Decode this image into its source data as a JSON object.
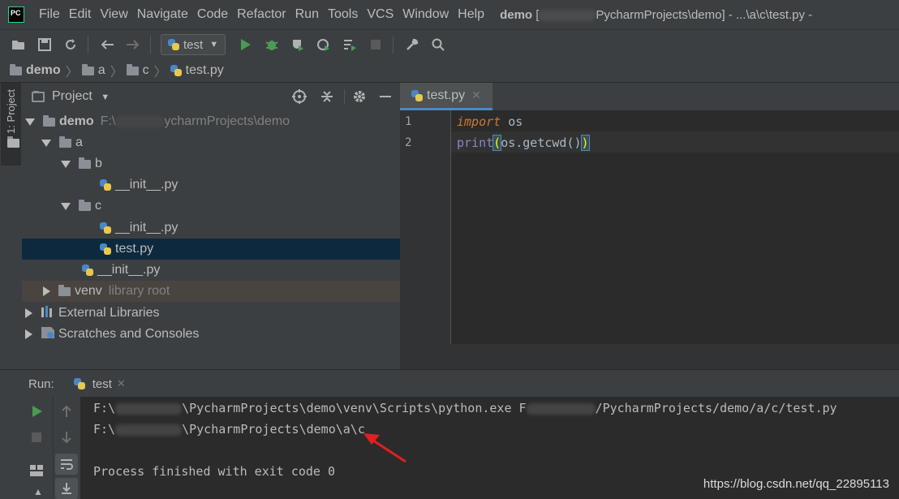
{
  "menu": {
    "items": [
      {
        "label": "File"
      },
      {
        "label": "Edit"
      },
      {
        "label": "View"
      },
      {
        "label": "Navigate"
      },
      {
        "label": "Code"
      },
      {
        "label": "Refactor"
      },
      {
        "label": "Run"
      },
      {
        "label": "Tools"
      },
      {
        "label": "VCS"
      },
      {
        "label": "Window"
      },
      {
        "label": "Help"
      }
    ],
    "title_project": "demo",
    "title_path": "PycharmProjects\\demo] - ...\\a\\c\\test.py -"
  },
  "toolbar": {
    "run_config": "test"
  },
  "breadcrumb": [
    "demo",
    "a",
    "c",
    "test.py"
  ],
  "left_stripe": {
    "project_label": "1: Project"
  },
  "project_panel": {
    "title": "Project",
    "tree": [
      {
        "label": "demo",
        "path": "F:\\",
        "path_suffix": "ycharmProjects\\demo",
        "kind": "folder",
        "depth": 0,
        "expanded": true
      },
      {
        "label": "a",
        "kind": "folder",
        "depth": 1,
        "expanded": true
      },
      {
        "label": "b",
        "kind": "folder",
        "depth": 2,
        "expanded": true
      },
      {
        "label": "__init__.py",
        "kind": "py",
        "depth": 3
      },
      {
        "label": "c",
        "kind": "folder",
        "depth": 2,
        "expanded": true
      },
      {
        "label": "__init__.py",
        "kind": "py",
        "depth": 3
      },
      {
        "label": "test.py",
        "kind": "py",
        "depth": 3,
        "selected": true
      },
      {
        "label": "__init__.py",
        "kind": "py",
        "depth": 2
      },
      {
        "label": "venv",
        "note": "library root",
        "kind": "folder",
        "depth": 1,
        "expanded": false
      },
      {
        "label": "External Libraries",
        "kind": "lib",
        "depth": 0,
        "expanded": false
      },
      {
        "label": "Scratches and Consoles",
        "kind": "scratch",
        "depth": 0,
        "expanded": false
      }
    ]
  },
  "editor": {
    "tab": "test.py",
    "lines": [
      {
        "no": "1",
        "kw": "import",
        "rest": " os"
      },
      {
        "no": "2",
        "fn": "print",
        "open": "(",
        "mid": "os.getcwd()",
        "close": ")"
      }
    ]
  },
  "run": {
    "label": "Run:",
    "tab": "test",
    "console": [
      {
        "a": "F:\\",
        "b": "\\PycharmProjects\\demo\\venv\\Scripts\\python.exe F",
        "c": "/PycharmProjects/demo/a/c/test.py"
      },
      {
        "a": "F:\\",
        "b": "\\PycharmProjects\\demo\\a\\c",
        "c": ""
      },
      {
        "a": "",
        "b": "",
        "c": ""
      },
      {
        "a": "Process finished with exit code 0",
        "b": "",
        "c": ""
      }
    ]
  },
  "watermark": "https://blog.csdn.net/qq_22895113",
  "colors": {
    "selection": "#0d293e",
    "accent": "#4a88c7",
    "run_green": "#499c54",
    "arrow": "#e51e1e"
  }
}
